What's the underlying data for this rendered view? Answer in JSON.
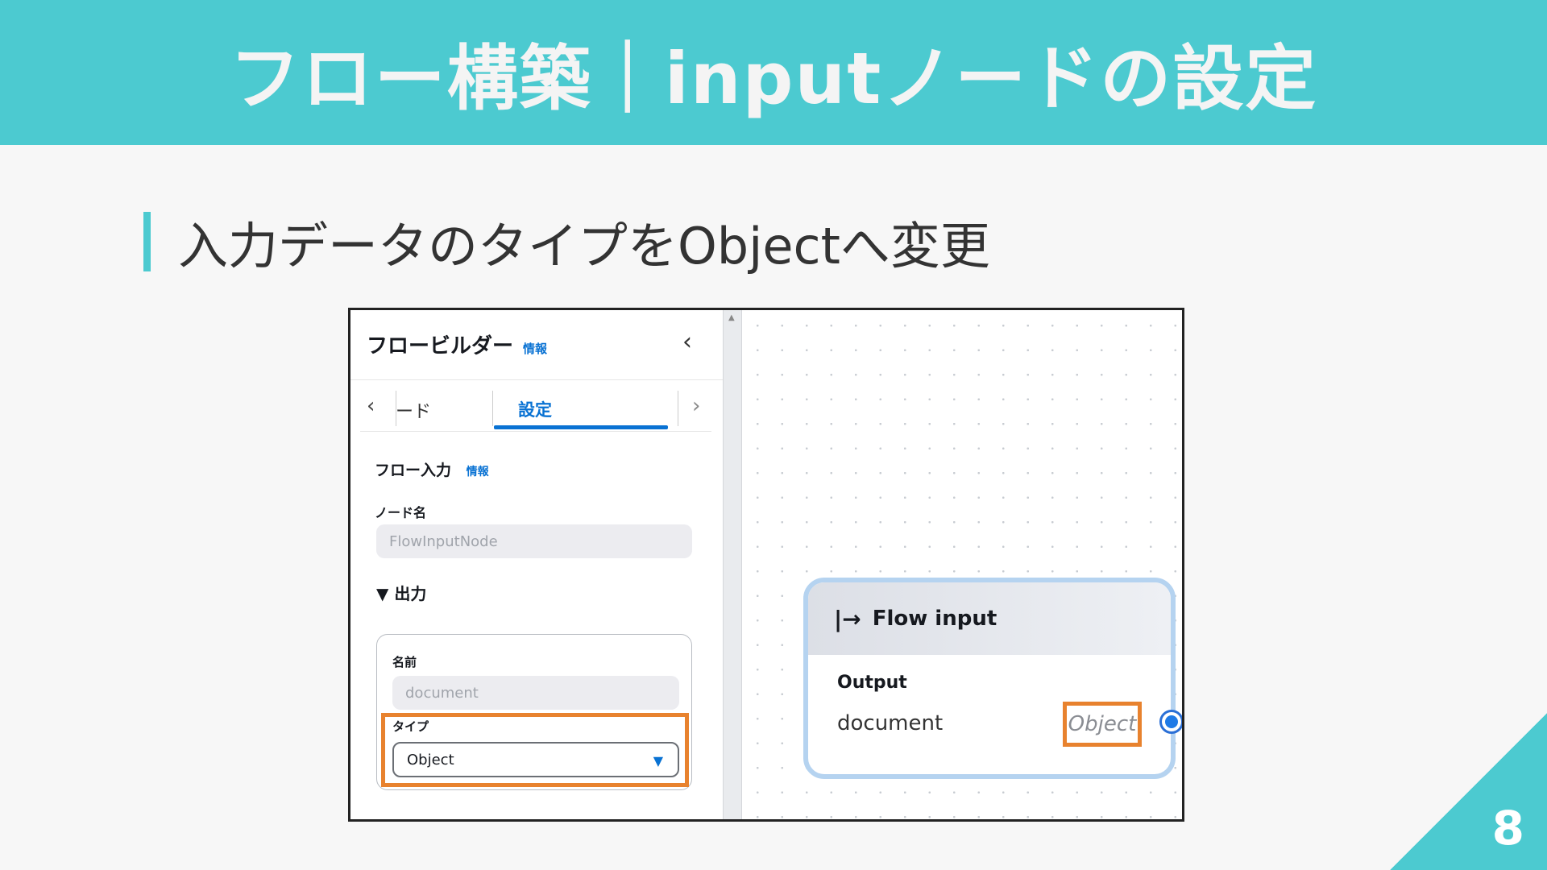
{
  "slide": {
    "title": "フロー構築｜inputノードの設定",
    "subtitle": "入力データのタイプをObjectへ変更",
    "page_number": "8"
  },
  "panel": {
    "title": "フロービルダー",
    "info": "情報",
    "tabs": {
      "partial_label": "ード",
      "active_label": "設定"
    },
    "section": {
      "title": "フロー入力",
      "info": "情報"
    },
    "node_name_label": "ノード名",
    "node_name_value": "FlowInputNode",
    "output_toggle": "▼ 出力",
    "output": {
      "name_label": "名前",
      "name_value": "document",
      "type_label": "タイプ",
      "type_value": "Object"
    }
  },
  "canvas": {
    "node": {
      "title": "Flow input",
      "output_label": "Output",
      "var_name": "document",
      "var_type": "Object"
    }
  },
  "colors": {
    "accent": "#4ccad0",
    "highlight": "#e8822e",
    "link": "#0972d3"
  }
}
